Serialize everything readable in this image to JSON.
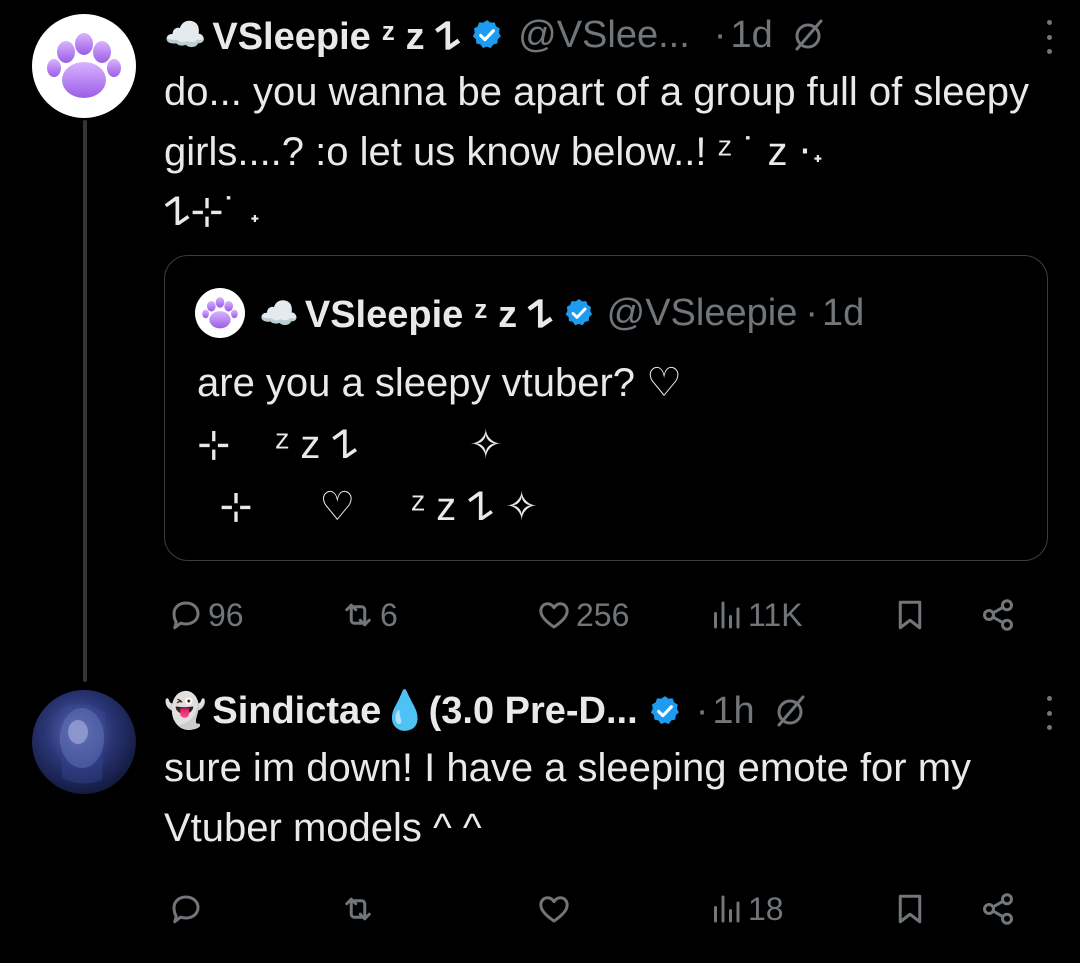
{
  "colors": {
    "background": "#000000",
    "text": "#e7e9ea",
    "muted": "#71767b",
    "verified": "#1d9bf0",
    "border": "#3a3d40"
  },
  "tweet1": {
    "emoji": "☁️",
    "name": "VSleepie ᶻ z 𐰁",
    "handle": "@VSlee...",
    "dot": "·",
    "time": "1d",
    "text": "do... you wanna be apart of a group full of sleepy girls....? :o let us know below..! ᶻ ˙ z ⋅˖\n𐰁⊹˙ ˖",
    "quote": {
      "emoji": "☁️",
      "name": "VSleepie ᶻ z 𐰁",
      "handle": "@VSleepie",
      "dot": "·",
      "time": "1d",
      "line1": "are you a sleepy vtuber? ♡",
      "line2": "⊹    ᶻ z 𐰁          ✧",
      "line3": "  ⊹      ♡     ᶻ z 𐰁 ✧"
    },
    "actions": {
      "replies": "96",
      "retweets": "6",
      "likes": "256",
      "views": "11K"
    }
  },
  "tweet2": {
    "emoji": "👻",
    "name": "Sindictae💧(3.0 Pre-D...",
    "dot": "·",
    "time": "1h",
    "text": "sure im down! I have a sleeping emote for my Vtuber models ^ ^",
    "actions": {
      "views": "18"
    }
  }
}
